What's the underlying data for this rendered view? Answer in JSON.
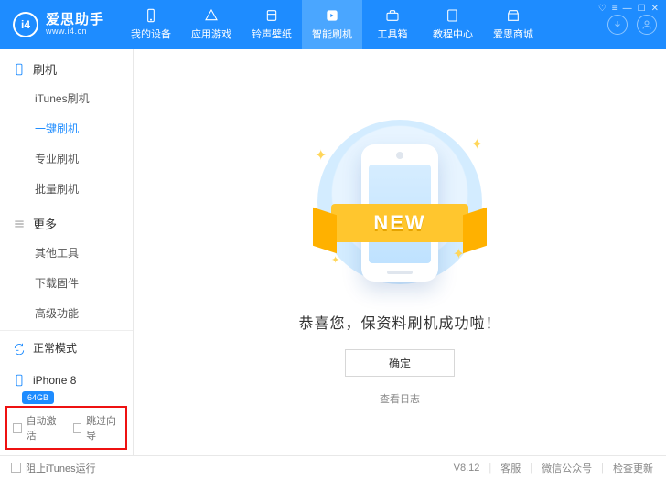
{
  "brand": {
    "badge": "i4",
    "name": "爱思助手",
    "url": "www.i4.cn"
  },
  "nav": [
    {
      "label": "我的设备"
    },
    {
      "label": "应用游戏"
    },
    {
      "label": "铃声壁纸"
    },
    {
      "label": "智能刷机"
    },
    {
      "label": "工具箱"
    },
    {
      "label": "教程中心"
    },
    {
      "label": "爱思商城"
    }
  ],
  "nav_active": 3,
  "sidebar": {
    "group1": {
      "title": "刷机",
      "items": [
        "iTunes刷机",
        "一键刷机",
        "专业刷机",
        "批量刷机"
      ],
      "active": 1
    },
    "group2": {
      "title": "更多",
      "items": [
        "其他工具",
        "下载固件",
        "高级功能"
      ]
    },
    "mode": "正常模式",
    "device": {
      "name": "iPhone 8",
      "storage": "64GB"
    },
    "opts": {
      "auto_activate": "自动激活",
      "skip_guide": "跳过向导"
    }
  },
  "main": {
    "ribbon": "NEW",
    "message": "恭喜您，保资料刷机成功啦！",
    "confirm": "确定",
    "log": "查看日志"
  },
  "footer": {
    "block_itunes": "阻止iTunes运行",
    "version": "V8.12",
    "links": [
      "客服",
      "微信公众号",
      "检查更新"
    ]
  }
}
